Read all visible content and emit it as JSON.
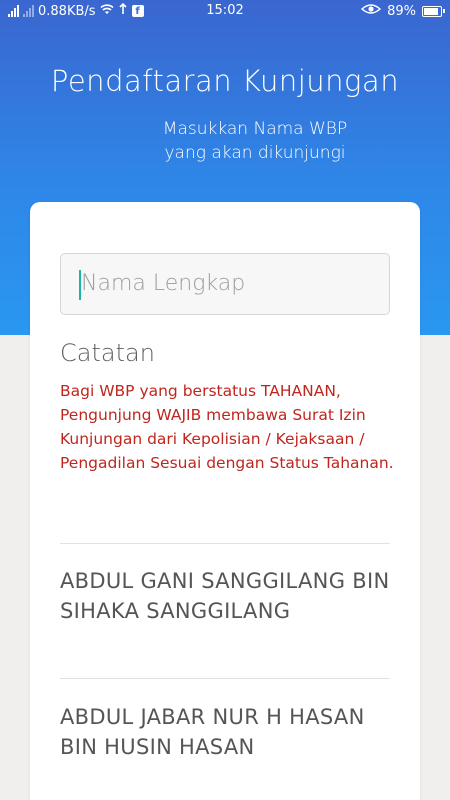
{
  "status_bar": {
    "network_speed": "0.88KB/s",
    "time": "15:02",
    "battery": "89%",
    "icons": [
      "signal-icon",
      "signal-icon",
      "wifi-icon",
      "sync-icon",
      "facebook-icon",
      "eye-icon",
      "battery-icon"
    ]
  },
  "header": {
    "title": "Pendaftaran Kunjungan",
    "subtitle_line1": "Masukkan Nama WBP",
    "subtitle_line2": "yang akan dikunjungi"
  },
  "search": {
    "placeholder": "Nama Lengkap",
    "value": ""
  },
  "note": {
    "title": "Catatan",
    "text": "Bagi WBP yang berstatus TAHANAN, Pengunjung WAJIB membawa Surat Izin Kunjungan dari Kepolisian / Kejaksaan / Pengadilan Sesuai dengan Status Tahanan.",
    "color": "#c0261e"
  },
  "results": [
    {
      "name": "ABDUL GANI SANGGILANG BIN SIHAKA SANGGILANG"
    },
    {
      "name": "ABDUL JABAR NUR H HASAN BIN HUSIN HASAN"
    }
  ],
  "colors": {
    "header_top": "#3a66cf",
    "header_bottom": "#2a97f0",
    "background": "#f1efed",
    "caret": "#19b6a8"
  }
}
